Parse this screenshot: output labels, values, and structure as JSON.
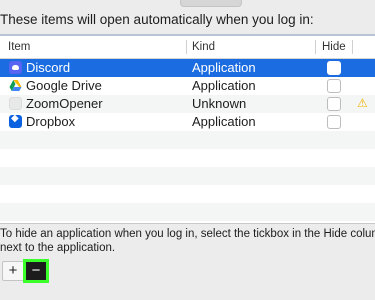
{
  "heading": "These items will open automatically when you log in:",
  "columns": {
    "item": "Item",
    "kind": "Kind",
    "hide": "Hide"
  },
  "rows": [
    {
      "name": "Discord",
      "kind": "Application",
      "icon": "discord-icon",
      "selected": true,
      "hidden": false
    },
    {
      "name": "Google Drive",
      "kind": "Application",
      "icon": "google-drive-icon",
      "selected": false,
      "hidden": false
    },
    {
      "name": "ZoomOpener",
      "kind": "Unknown",
      "icon": "generic-app-icon",
      "selected": false,
      "hidden": false,
      "warning": "warning-icon"
    },
    {
      "name": "Dropbox",
      "kind": "Application",
      "icon": "dropbox-icon",
      "selected": false,
      "hidden": false
    }
  ],
  "footer": {
    "line1": "To hide an application when you log in, select the tickbox in the Hide column",
    "line2": "next to the application."
  },
  "buttons": {
    "add": "+",
    "remove": "−"
  },
  "colors": {
    "selection": "#1b6ce0",
    "highlight": "#3bff2a",
    "warning": "#f0b400"
  }
}
